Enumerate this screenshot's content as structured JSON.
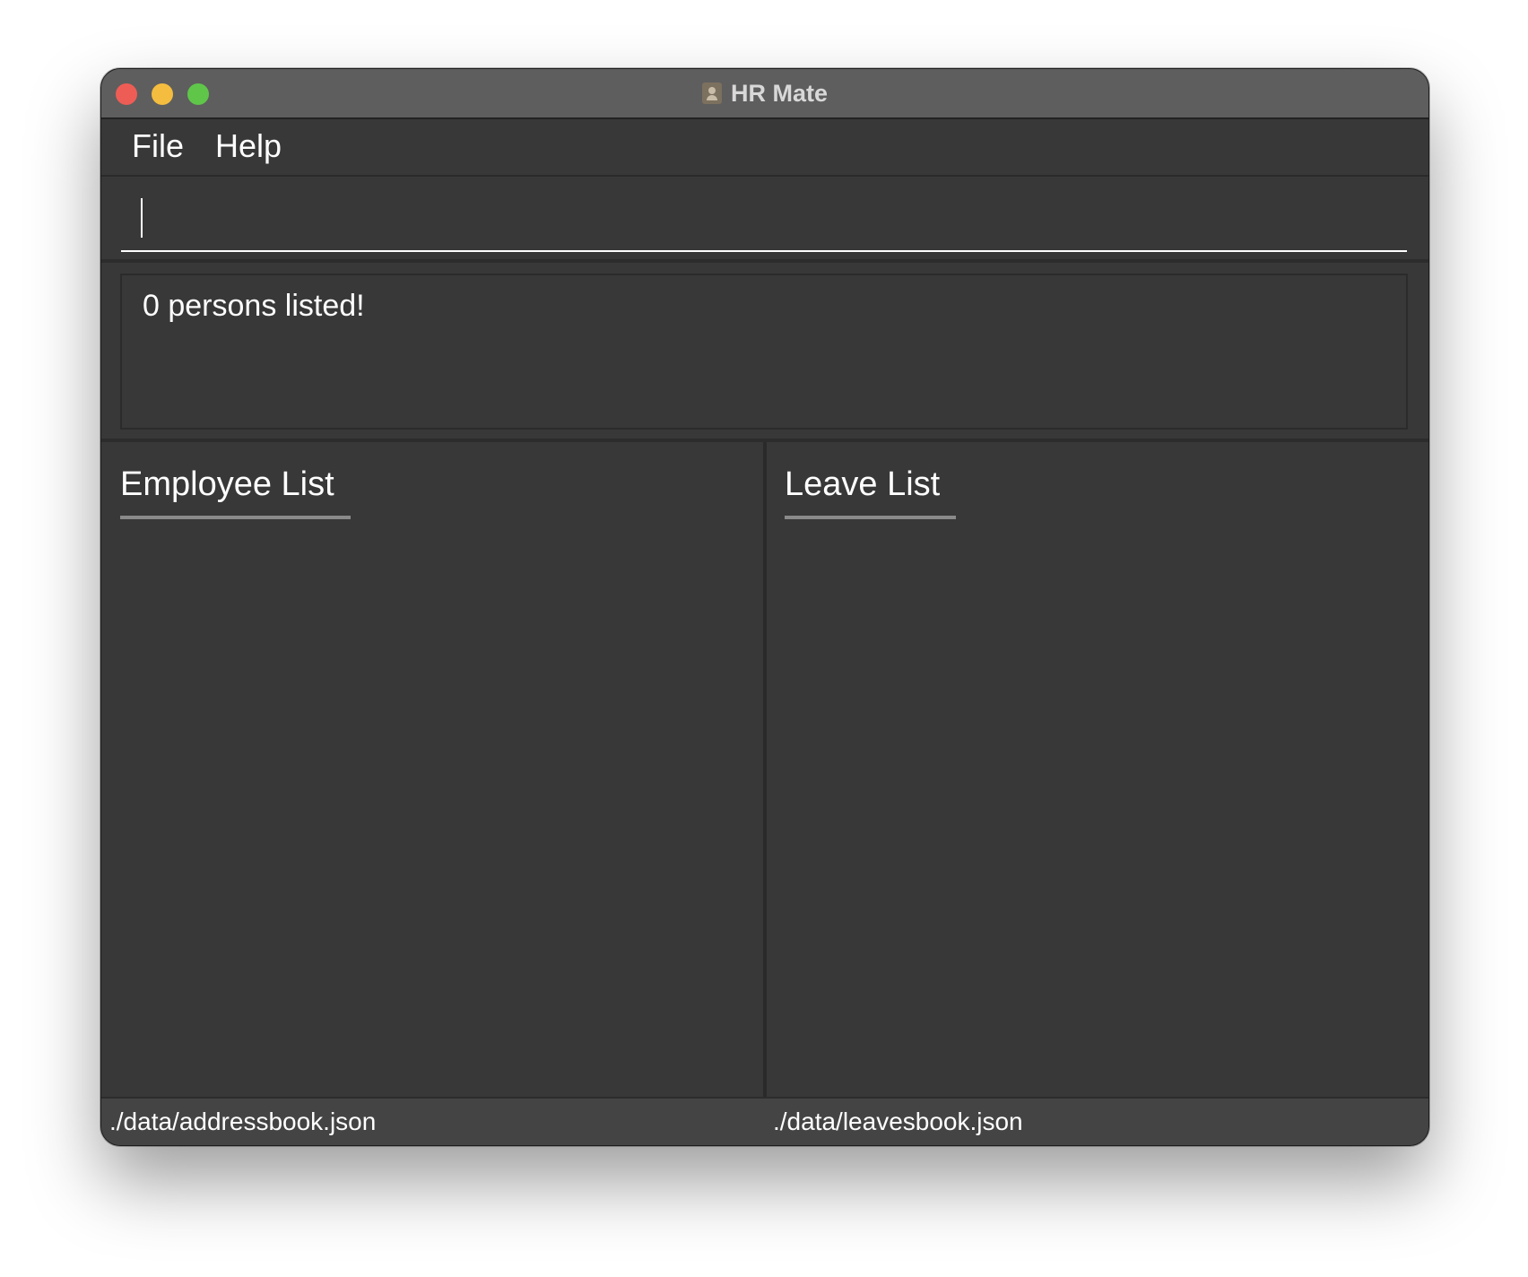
{
  "window": {
    "title": "HR Mate",
    "app_icon": "contact-card-icon"
  },
  "menu": {
    "file_label": "File",
    "help_label": "Help"
  },
  "command_box": {
    "value": "",
    "placeholder": ""
  },
  "result_display": {
    "text": "0 persons listed!"
  },
  "employee_panel": {
    "title": "Employee List"
  },
  "leave_panel": {
    "title": "Leave List"
  },
  "status_bar": {
    "addressbook_path": "./data/addressbook.json",
    "leavesbook_path": "./data/leavesbook.json"
  },
  "colors": {
    "background": "#383838",
    "titlebar": "#5e5e5e",
    "statusbar": "#444444",
    "close": "#ee5d55",
    "minimize": "#f4bd3f",
    "maximize": "#5fc64a",
    "text": "#ffffff"
  }
}
